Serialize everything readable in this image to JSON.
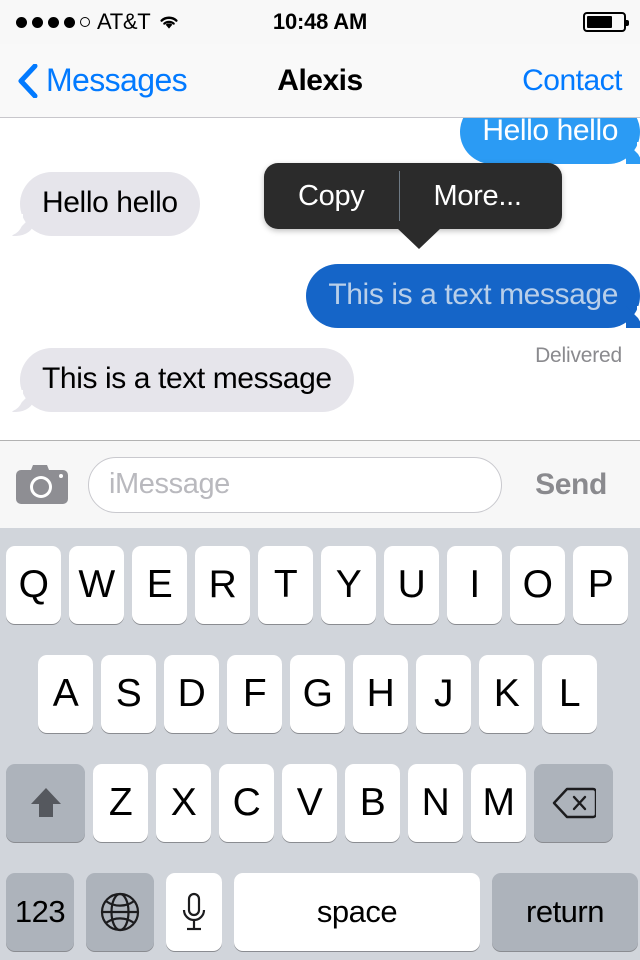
{
  "status_bar": {
    "signal_dots_total": 5,
    "signal_dots_filled": 4,
    "carrier": "AT&T",
    "wifi_icon": "wifi-icon",
    "time": "10:48 AM",
    "battery_percent": 70,
    "battery_icon": "battery-icon"
  },
  "nav_bar": {
    "back_icon": "chevron-left-icon",
    "back_label": "Messages",
    "title": "Alexis",
    "right_action": "Contact",
    "tint_color": "#027aff"
  },
  "conversation": {
    "messages": [
      {
        "id": "m1",
        "text": "Hello hello",
        "side": "sent",
        "selected": false
      },
      {
        "id": "m2",
        "text": "Hello hello",
        "side": "received",
        "selected": false
      },
      {
        "id": "m3",
        "text": "This is a text message",
        "side": "sent",
        "selected": true,
        "status": "Delivered"
      },
      {
        "id": "m4",
        "text": "This is a text message",
        "side": "received",
        "selected": false
      }
    ],
    "delivered_label": "Delivered",
    "sent_bubble_color": "#2b9bf4",
    "sent_selected_color": "#1565c8",
    "received_bubble_color": "#e6e5eb"
  },
  "context_menu": {
    "background_color": "#2b2b2b",
    "items": [
      {
        "label": "Copy",
        "name": "context-menu-copy"
      },
      {
        "label": "More...",
        "name": "context-menu-more"
      }
    ]
  },
  "toolbar": {
    "camera_icon": "camera-icon",
    "input_placeholder": "iMessage",
    "input_value": "",
    "send_label": "Send"
  },
  "keyboard": {
    "background_color": "#d1d5db",
    "row1": [
      "Q",
      "W",
      "E",
      "R",
      "T",
      "Y",
      "U",
      "I",
      "O",
      "P"
    ],
    "row2": [
      "A",
      "S",
      "D",
      "F",
      "G",
      "H",
      "J",
      "K",
      "L"
    ],
    "row3_letters": [
      "Z",
      "X",
      "C",
      "V",
      "B",
      "N",
      "M"
    ],
    "shift_icon": "shift-arrow-up-icon",
    "backspace_icon": "backspace-delete-icon",
    "row4": {
      "numeric_label": "123",
      "globe_icon": "globe-icon",
      "mic_icon": "microphone-icon",
      "space_label": "space",
      "return_label": "return"
    }
  }
}
